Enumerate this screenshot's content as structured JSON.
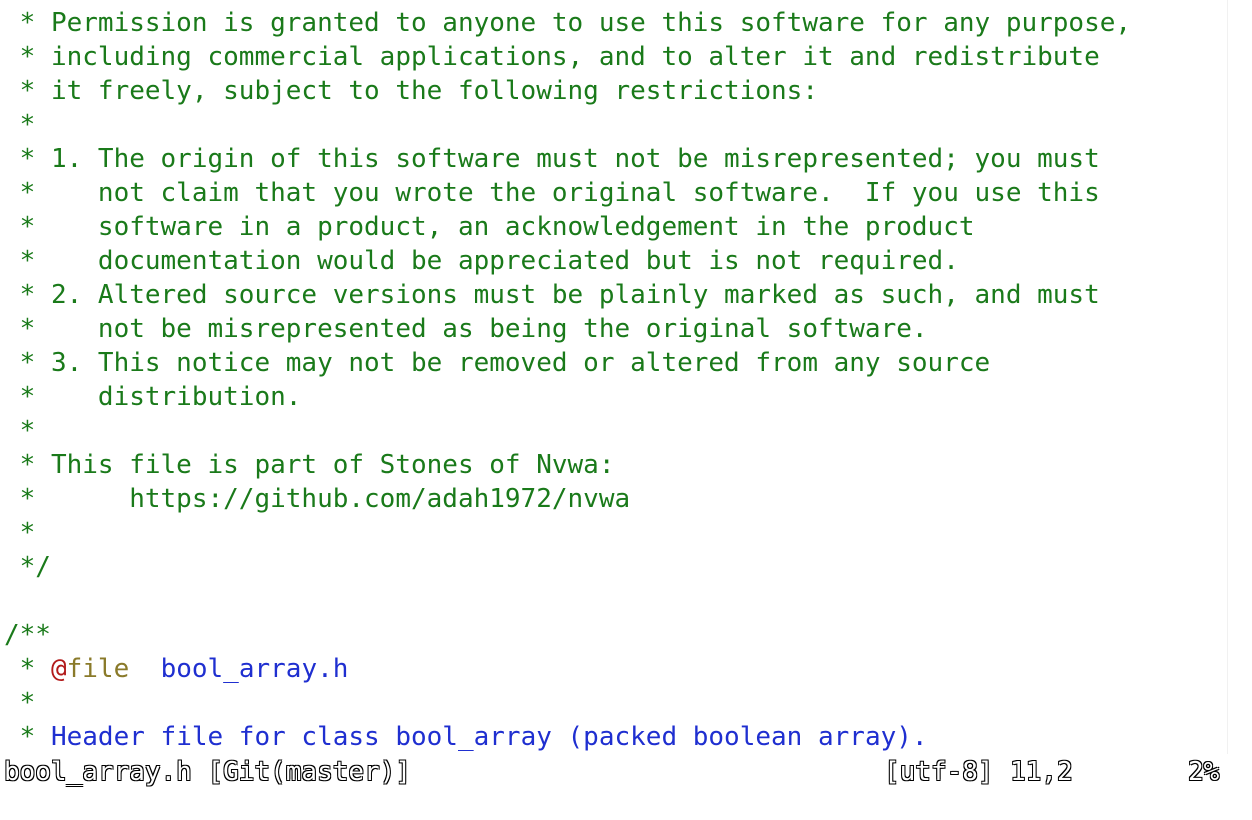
{
  "editor": {
    "lines": [
      " * Permission is granted to anyone to use this software for any purpose,",
      " * including commercial applications, and to alter it and redistribute",
      " * it freely, subject to the following restrictions:",
      " *",
      " * 1. The origin of this software must not be misrepresented; you must",
      " *    not claim that you wrote the original software.  If you use this",
      " *    software in a product, an acknowledgement in the product",
      " *    documentation would be appreciated but is not required.",
      " * 2. Altered source versions must be plainly marked as such, and must",
      " *    not be misrepresented as being the original software.",
      " * 3. This notice may not be removed or altered from any source",
      " *    distribution.",
      " *",
      " * This file is part of Stones of Nvwa:",
      " *      https://github.com/adah1972/nvwa",
      " *",
      " */",
      "",
      "/**"
    ],
    "doc_file_line": {
      "prefix": " * ",
      "at": "@",
      "keyword": "file",
      "gap": "  ",
      "value": "bool_array.h"
    },
    "doc_blank_line": " *",
    "doc_desc_line": {
      "prefix": " * ",
      "text": "Header file for class bool_array (packed boolean array)."
    }
  },
  "statusline": {
    "filename": "bool_array.h [Git(master)]",
    "encoding": "[utf-8]",
    "position": "11,2",
    "percent": "2%"
  }
}
